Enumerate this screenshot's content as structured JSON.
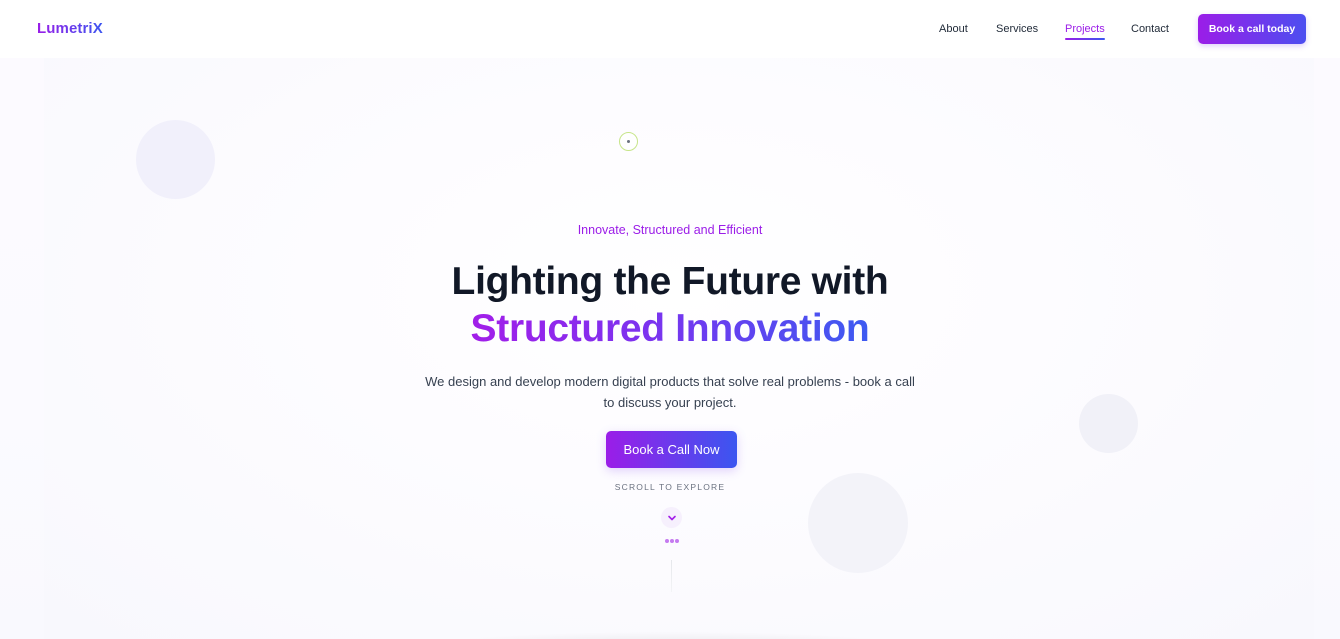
{
  "brand": {
    "name": "LumetriX"
  },
  "nav": {
    "items": [
      {
        "label": "About",
        "active": false
      },
      {
        "label": "Services",
        "active": false
      },
      {
        "label": "Projects",
        "active": true
      },
      {
        "label": "Contact",
        "active": false
      }
    ],
    "cta_label": "Book a call today"
  },
  "hero": {
    "tagline": "Innovate, Structured and Efficient",
    "headline": "Lighting the Future with",
    "headline_accent": "Structured Innovation",
    "lede": "We design and develop modern digital products that solve real problems - book a call to discuss your project.",
    "cta_label": "Book a Call Now",
    "scroll_label": "SCROLL TO EXPLORE",
    "scroll_icon": "chevron-down-icon"
  },
  "colors": {
    "accent_start": "#9b1de8",
    "accent_end": "#3b56f0",
    "text_dark": "#111827",
    "text_body": "#374151"
  }
}
